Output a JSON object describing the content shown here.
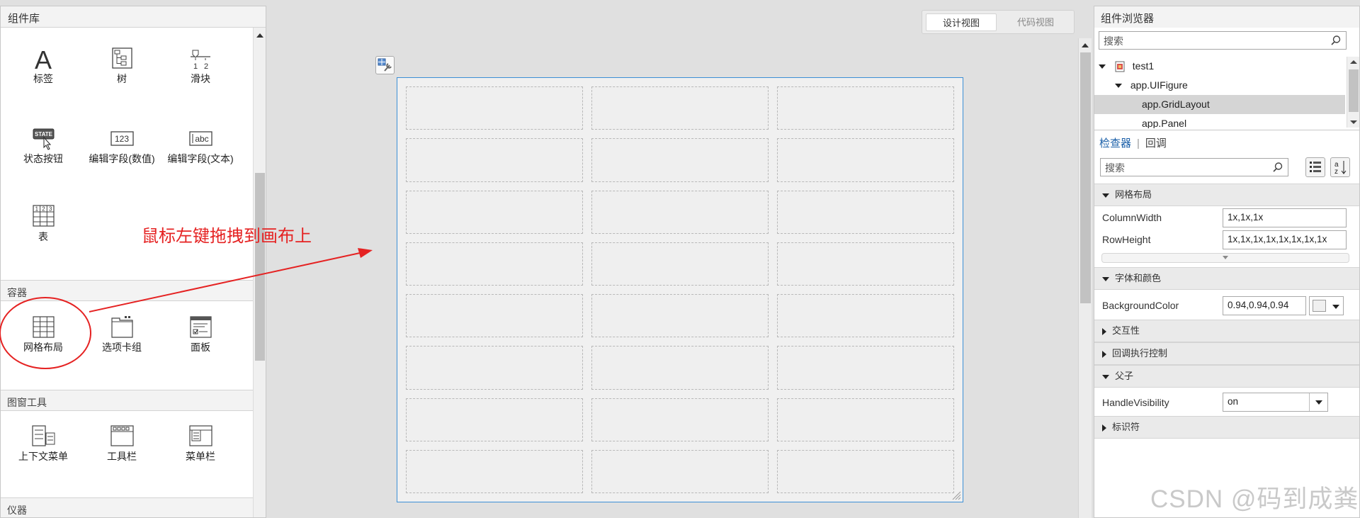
{
  "library": {
    "title": "组件库",
    "components_row1": [
      {
        "label": "标签",
        "icon": "label-A-icon"
      },
      {
        "label": "树",
        "icon": "tree-icon"
      },
      {
        "label": "滑块",
        "icon": "slider-icon"
      }
    ],
    "slider_ticks": [
      "1",
      "2"
    ],
    "components_row2": [
      {
        "label": "状态按钮",
        "icon": "state-button-icon"
      },
      {
        "label": "编辑字段(数值)",
        "icon": "numeric-edit-field-icon"
      },
      {
        "label": "编辑字段(文本)",
        "icon": "text-edit-field-icon"
      }
    ],
    "state_icon_text": "STATE",
    "numeric_icon_text": "123",
    "text_icon_text": "abc",
    "table_component": {
      "label": "表",
      "icon": "table-icon",
      "header_digits": [
        "1",
        "2",
        "3"
      ]
    },
    "section_container": "容器",
    "containers": [
      {
        "label": "网格布局",
        "icon": "grid-layout-icon"
      },
      {
        "label": "选项卡组",
        "icon": "tab-group-icon"
      },
      {
        "label": "面板",
        "icon": "panel-icon"
      }
    ],
    "section_figure_tools": "图窗工具",
    "figure_tools": [
      {
        "label": "上下文菜单",
        "icon": "context-menu-icon"
      },
      {
        "label": "工具栏",
        "icon": "toolbar-icon"
      },
      {
        "label": "菜单栏",
        "icon": "menubar-icon"
      }
    ],
    "section_instruments": "仪器"
  },
  "annotation": {
    "text": "鼠标左键拖拽到画布上",
    "color": "#e52222"
  },
  "view_toggle": {
    "design": "设计视图",
    "code": "代码视图",
    "active": "design"
  },
  "canvas": {
    "grid_rows": 8,
    "grid_cols": 3,
    "border_color": "#3c8fd6"
  },
  "browser": {
    "title": "组件浏览器",
    "search_placeholder": "搜索",
    "tree": [
      {
        "label": "test1",
        "level": 0,
        "expanded": true,
        "icon": "app-file-icon"
      },
      {
        "label": "app.UIFigure",
        "level": 1,
        "expanded": true
      },
      {
        "label": "app.GridLayout",
        "level": 2,
        "selected": true
      },
      {
        "label": "app.Panel",
        "level": 2
      }
    ]
  },
  "inspector": {
    "tab_inspector": "检查器",
    "tab_separator": "|",
    "tab_callback": "回调",
    "search_placeholder": "搜索",
    "groups": {
      "grid": "网格布局",
      "font_color": "字体和颜色",
      "interactivity": "交互性",
      "callback_exec": "回调执行控制",
      "parent_child": "父子",
      "identifiers": "标识符"
    },
    "props": {
      "column_width_label": "ColumnWidth",
      "column_width_value": "1x,1x,1x",
      "row_height_label": "RowHeight",
      "row_height_value": "1x,1x,1x,1x,1x,1x,1x,1x",
      "bg_color_label": "BackgroundColor",
      "bg_color_value": "0.94,0.94,0.94",
      "handle_vis_label": "HandleVisibility",
      "handle_vis_value": "on"
    }
  },
  "watermark": "CSDN @码到成粪"
}
